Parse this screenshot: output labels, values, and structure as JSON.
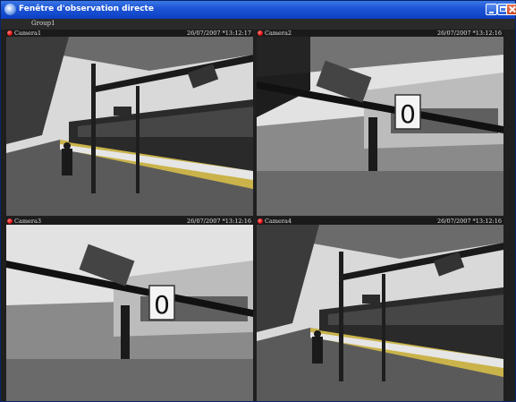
{
  "window": {
    "title": "Fenêtre d'observation directe",
    "group_label": "Group1"
  },
  "cameras": [
    {
      "name": "Camera1",
      "timestamp": "26/07/2007 *13:12:17",
      "status": "recording",
      "status_color": "#e01010",
      "view": "platform-wide"
    },
    {
      "name": "Camera2",
      "timestamp": "26/07/2007 *13:12:16",
      "status": "recording",
      "status_color": "#e01010",
      "view": "sign-closeup"
    },
    {
      "name": "Camera3",
      "timestamp": "26/07/2007 *13:12:16",
      "status": "recording",
      "status_color": "#e01010",
      "view": "sign-closeup"
    },
    {
      "name": "Camera4",
      "timestamp": "26/07/2007 *13:12:16",
      "status": "recording",
      "status_color": "#e01010",
      "view": "platform-wide"
    }
  ],
  "platform_sign": {
    "number": "0"
  }
}
